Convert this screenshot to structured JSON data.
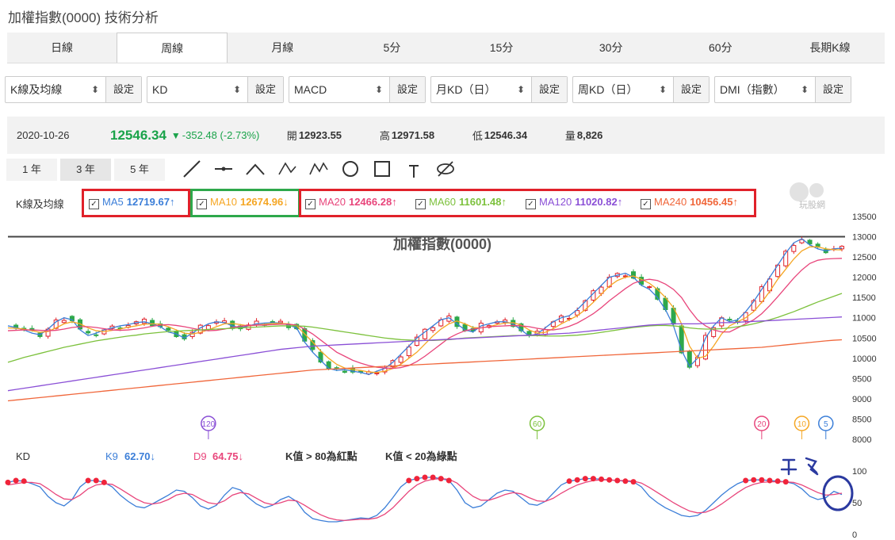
{
  "page_title": "加權指數(0000) 技術分析",
  "tabs": [
    "日線",
    "周線",
    "月線",
    "5分",
    "15分",
    "30分",
    "60分",
    "長期K線"
  ],
  "active_tab": 1,
  "selects": [
    {
      "value": "K線及均線",
      "button": "設定"
    },
    {
      "value": "KD",
      "button": "設定"
    },
    {
      "value": "MACD",
      "button": "設定"
    },
    {
      "value": "月KD（日）",
      "button": "設定"
    },
    {
      "value": "周KD（日）",
      "button": "設定"
    },
    {
      "value": "DMI（指數）",
      "button": "設定"
    }
  ],
  "quote": {
    "date": "2020-10-26",
    "price": "12546.34",
    "change": "-352.48 (-2.73%)",
    "open_label": "開",
    "open": "12923.55",
    "high_label": "高",
    "high": "12971.58",
    "low_label": "低",
    "low": "12546.34",
    "vol_label": "量",
    "vol": "8,826"
  },
  "ranges": [
    "1 年",
    "3 年",
    "5 年"
  ],
  "active_range": 1,
  "tool_icons": [
    "line-tool-icon",
    "horizontal-line-tool-icon",
    "angle-tool-icon",
    "abc-tool-icon",
    "abcd-tool-icon",
    "circle-tool-icon",
    "rectangle-tool-icon",
    "text-tool-icon",
    "hide-tool-icon"
  ],
  "ma_label": "K線及均線",
  "ma": [
    {
      "name": "MA5",
      "value": "12719.67",
      "arrow": "↑",
      "color": "#3b7ed8"
    },
    {
      "name": "MA10",
      "value": "12674.96",
      "arrow": "↓",
      "color": "#f5a623"
    },
    {
      "name": "MA20",
      "value": "12466.28",
      "arrow": "↑",
      "color": "#e8457b"
    },
    {
      "name": "MA60",
      "value": "11601.48",
      "arrow": "↑",
      "color": "#7cc13c"
    },
    {
      "name": "MA120",
      "value": "11020.82",
      "arrow": "↑",
      "color": "#8a4fd6"
    },
    {
      "name": "MA240",
      "value": "10456.45",
      "arrow": "↑",
      "color": "#f0663a"
    }
  ],
  "watermark": "玩股網",
  "chart_data": [
    {
      "type": "candlestick",
      "title": "加權指數(0000)",
      "ylim": [
        8000,
        13500
      ],
      "yticks": [
        8000,
        8500,
        9000,
        9500,
        10000,
        10500,
        11000,
        11500,
        12000,
        12500,
        13000,
        13500
      ],
      "reference_line": 13000,
      "series": [
        {
          "name": "MA5",
          "values": [
            10800,
            10760,
            10700,
            10620,
            10580,
            10720,
            10900,
            11000,
            10950,
            10700,
            10560,
            10620,
            10700,
            10750,
            10800,
            10830,
            10880,
            10900,
            10850,
            10780,
            10650,
            10600,
            10500,
            10620,
            10750,
            10850,
            10900,
            10880,
            10800,
            10750,
            10800,
            10850,
            10870,
            10880,
            10870,
            10820,
            10750,
            10400,
            10150,
            9950,
            9750,
            9700,
            9720,
            9680,
            9650,
            9600,
            9680,
            9750,
            9900,
            10100,
            10300,
            10500,
            10650,
            10800,
            10950,
            11000,
            10850,
            10700,
            10650,
            10800,
            10850,
            10900,
            10900,
            10850,
            10700,
            10550,
            10600,
            10750,
            10900,
            11000,
            11050,
            11200,
            11400,
            11600,
            11800,
            12000,
            12050,
            12100,
            12000,
            11800,
            11700,
            11500,
            11200,
            10800,
            10200,
            9800,
            10000,
            10500,
            10800,
            11000,
            10900,
            10950,
            11150,
            11400,
            11700,
            12000,
            12300,
            12600,
            12850,
            12950,
            12800,
            12700,
            12650,
            12700,
            12720
          ]
        },
        {
          "name": "MA10",
          "values": [
            10750,
            10740,
            10720,
            10680,
            10640,
            10660,
            10750,
            10850,
            10900,
            10850,
            10750,
            10680,
            10660,
            10690,
            10720,
            10770,
            10800,
            10840,
            10850,
            10840,
            10780,
            10700,
            10620,
            10600,
            10640,
            10700,
            10780,
            10850,
            10860,
            10830,
            10800,
            10820,
            10840,
            10860,
            10860,
            10850,
            10800,
            10600,
            10400,
            10180,
            10000,
            9850,
            9760,
            9720,
            9700,
            9660,
            9650,
            9680,
            9750,
            9850,
            10000,
            10150,
            10350,
            10550,
            10720,
            10850,
            10920,
            10850,
            10760,
            10750,
            10780,
            10830,
            10870,
            10880,
            10820,
            10700,
            10620,
            10640,
            10730,
            10850,
            10950,
            11050,
            11200,
            11380,
            11580,
            11780,
            11920,
            12000,
            12030,
            11950,
            11850,
            11700,
            11500,
            11250,
            10850,
            10300,
            10000,
            10050,
            10300,
            10600,
            10800,
            10900,
            11000,
            11150,
            11380,
            11650,
            11950,
            12200,
            12450,
            12650,
            12750,
            12750,
            12700,
            12680,
            12675
          ]
        },
        {
          "name": "MA20",
          "values": [
            10680,
            10690,
            10700,
            10700,
            10690,
            10680,
            10690,
            10720,
            10760,
            10780,
            10780,
            10760,
            10730,
            10700,
            10690,
            10700,
            10720,
            10750,
            10790,
            10820,
            10830,
            10810,
            10780,
            10740,
            10700,
            10680,
            10690,
            10720,
            10760,
            10790,
            10810,
            10820,
            10820,
            10830,
            10840,
            10840,
            10820,
            10720,
            10600,
            10450,
            10300,
            10150,
            10050,
            9950,
            9880,
            9820,
            9780,
            9760,
            9750,
            9770,
            9820,
            9920,
            10050,
            10200,
            10350,
            10500,
            10600,
            10680,
            10720,
            10750,
            10780,
            10790,
            10800,
            10810,
            10800,
            10780,
            10740,
            10710,
            10700,
            10730,
            10790,
            10870,
            10980,
            11100,
            11250,
            11420,
            11570,
            11720,
            11850,
            11920,
            11950,
            11920,
            11830,
            11700,
            11500,
            11200,
            10950,
            10800,
            10700,
            10650,
            10650,
            10750,
            10850,
            10950,
            11100,
            11300,
            11520,
            11750,
            11980,
            12180,
            12340,
            12420,
            12450,
            12460,
            12466
          ]
        },
        {
          "name": "MA60",
          "values": [
            9900,
            9960,
            10020,
            10070,
            10120,
            10170,
            10220,
            10270,
            10310,
            10350,
            10390,
            10430,
            10460,
            10490,
            10520,
            10550,
            10570,
            10600,
            10620,
            10640,
            10660,
            10670,
            10680,
            10690,
            10700,
            10710,
            10720,
            10730,
            10740,
            10750,
            10760,
            10770,
            10780,
            10790,
            10800,
            10800,
            10800,
            10790,
            10770,
            10740,
            10710,
            10680,
            10650,
            10620,
            10590,
            10560,
            10530,
            10500,
            10480,
            10460,
            10450,
            10440,
            10440,
            10440,
            10450,
            10460,
            10480,
            10500,
            10510,
            10520,
            10530,
            10540,
            10550,
            10560,
            10560,
            10560,
            10560,
            10550,
            10550,
            10550,
            10560,
            10570,
            10590,
            10610,
            10640,
            10670,
            10700,
            10730,
            10760,
            10780,
            10800,
            10810,
            10810,
            10800,
            10780,
            10750,
            10730,
            10720,
            10720,
            10730,
            10750,
            10780,
            10810,
            10850,
            10900,
            10950,
            11010,
            11080,
            11150,
            11230,
            11310,
            11390,
            11460,
            11530,
            11601
          ]
        },
        {
          "name": "MA120",
          "values": [
            9200,
            9230,
            9260,
            9290,
            9320,
            9350,
            9380,
            9410,
            9440,
            9470,
            9500,
            9530,
            9560,
            9590,
            9620,
            9650,
            9680,
            9710,
            9740,
            9770,
            9800,
            9830,
            9860,
            9890,
            9920,
            9950,
            9980,
            10010,
            10040,
            10070,
            10100,
            10130,
            10160,
            10190,
            10220,
            10240,
            10260,
            10280,
            10300,
            10310,
            10320,
            10330,
            10340,
            10350,
            10360,
            10370,
            10380,
            10390,
            10400,
            10410,
            10420,
            10430,
            10440,
            10450,
            10460,
            10470,
            10480,
            10490,
            10500,
            10510,
            10520,
            10530,
            10540,
            10550,
            10560,
            10570,
            10580,
            10590,
            10600,
            10610,
            10620,
            10640,
            10660,
            10680,
            10700,
            10720,
            10740,
            10760,
            10780,
            10800,
            10820,
            10830,
            10840,
            10850,
            10850,
            10850,
            10850,
            10860,
            10870,
            10880,
            10880,
            10890,
            10900,
            10910,
            10920,
            10930,
            10940,
            10950,
            10960,
            10970,
            10980,
            10990,
            11000,
            11010,
            11020
          ]
        },
        {
          "name": "MA240",
          "values": [
            8950,
            8970,
            8990,
            9010,
            9030,
            9050,
            9070,
            9090,
            9110,
            9130,
            9150,
            9170,
            9190,
            9210,
            9230,
            9250,
            9270,
            9290,
            9310,
            9330,
            9350,
            9370,
            9390,
            9410,
            9430,
            9450,
            9470,
            9490,
            9510,
            9530,
            9550,
            9570,
            9590,
            9610,
            9630,
            9650,
            9670,
            9690,
            9710,
            9720,
            9730,
            9740,
            9750,
            9760,
            9770,
            9780,
            9790,
            9800,
            9810,
            9820,
            9830,
            9840,
            9850,
            9860,
            9870,
            9880,
            9890,
            9900,
            9910,
            9920,
            9930,
            9940,
            9950,
            9960,
            9970,
            9980,
            9990,
            10000,
            10010,
            10020,
            10030,
            10040,
            10050,
            10060,
            10070,
            10080,
            10090,
            10100,
            10110,
            10120,
            10130,
            10140,
            10150,
            10160,
            10170,
            10180,
            10190,
            10200,
            10210,
            10220,
            10230,
            10240,
            10250,
            10260,
            10270,
            10290,
            10310,
            10330,
            10350,
            10370,
            10390,
            10410,
            10430,
            10445,
            10456
          ]
        }
      ],
      "markers": [
        {
          "label": "120",
          "index": 25,
          "color": "#8a4fd6"
        },
        {
          "label": "60",
          "index": 66,
          "color": "#7cc13c"
        },
        {
          "label": "20",
          "index": 94,
          "color": "#e8457b"
        },
        {
          "label": "10",
          "index": 99,
          "color": "#f5a623"
        },
        {
          "label": "5",
          "index": 102,
          "color": "#3b7ed8"
        }
      ]
    },
    {
      "type": "line",
      "title": "KD",
      "ylim": [
        0,
        100
      ],
      "yticks": [
        0,
        50,
        100
      ],
      "legend": [
        {
          "name": "K9",
          "value": "62.70",
          "arrow": "↓",
          "color": "#3b7ed8"
        },
        {
          "name": "D9",
          "value": "64.75",
          "arrow": "↓",
          "color": "#e8457b"
        }
      ],
      "notes": [
        "K值 > 80為紅點",
        "K值 < 20為綠點"
      ],
      "series": [
        {
          "name": "K9",
          "values": [
            82,
            85,
            84,
            80,
            75,
            60,
            50,
            45,
            55,
            75,
            85,
            85,
            82,
            75,
            62,
            52,
            44,
            42,
            48,
            55,
            62,
            70,
            68,
            58,
            45,
            40,
            46,
            62,
            74,
            70,
            58,
            48,
            42,
            46,
            55,
            60,
            52,
            35,
            25,
            22,
            20,
            20,
            22,
            24,
            26,
            25,
            30,
            42,
            58,
            75,
            85,
            88,
            90,
            90,
            88,
            85,
            70,
            50,
            42,
            45,
            55,
            65,
            70,
            68,
            58,
            48,
            46,
            52,
            65,
            78,
            84,
            86,
            88,
            88,
            87,
            86,
            85,
            84,
            83,
            75,
            60,
            50,
            42,
            36,
            30,
            28,
            30,
            38,
            50,
            62,
            72,
            80,
            85,
            86,
            86,
            85,
            84,
            83,
            80,
            72,
            60,
            55,
            58,
            68,
            63
          ]
        },
        {
          "name": "D9",
          "values": [
            78,
            80,
            82,
            82,
            80,
            72,
            63,
            56,
            55,
            62,
            72,
            78,
            80,
            79,
            72,
            64,
            56,
            50,
            48,
            50,
            55,
            62,
            65,
            63,
            56,
            50,
            48,
            53,
            62,
            66,
            64,
            57,
            50,
            47,
            50,
            54,
            53,
            46,
            38,
            31,
            26,
            23,
            22,
            23,
            24,
            24,
            26,
            32,
            42,
            55,
            68,
            78,
            84,
            87,
            88,
            87,
            81,
            70,
            60,
            54,
            54,
            58,
            63,
            66,
            64,
            58,
            53,
            52,
            57,
            65,
            72,
            78,
            82,
            85,
            86,
            86,
            85,
            85,
            84,
            81,
            74,
            66,
            58,
            50,
            43,
            37,
            34,
            35,
            40,
            48,
            57,
            66,
            74,
            79,
            82,
            83,
            83,
            83,
            82,
            78,
            72,
            66,
            62,
            63,
            65
          ]
        }
      ]
    }
  ]
}
